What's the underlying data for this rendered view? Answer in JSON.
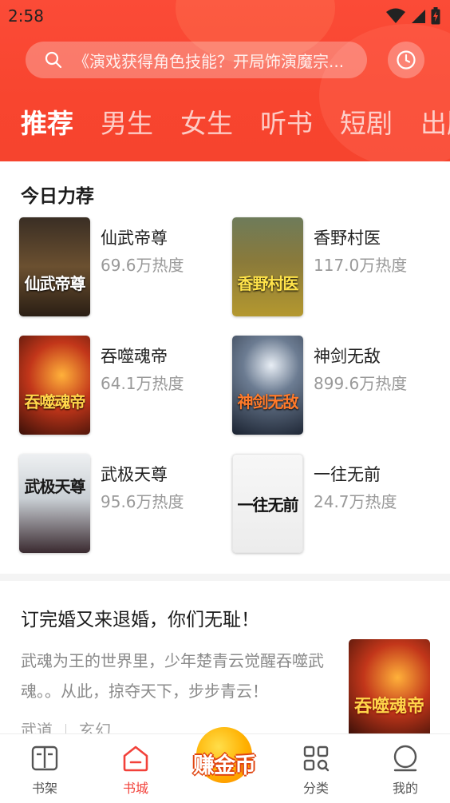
{
  "status_bar": {
    "time": "2:58"
  },
  "search": {
    "placeholder": "《演戏获得角色技能？开局饰演魔宗..."
  },
  "tabs": [
    {
      "label": "推荐",
      "active": true
    },
    {
      "label": "男生"
    },
    {
      "label": "女生"
    },
    {
      "label": "听书"
    },
    {
      "label": "短剧"
    },
    {
      "label": "出版"
    }
  ],
  "recommend": {
    "title": "今日力荐",
    "books": [
      {
        "title": "仙武帝尊",
        "heat": "69.6万热度",
        "cover_text": "仙武帝尊"
      },
      {
        "title": "香野村医",
        "heat": "117.0万热度",
        "cover_text": "香野村医"
      },
      {
        "title": "吞噬魂帝",
        "heat": "64.1万热度",
        "cover_text": "吞噬魂帝"
      },
      {
        "title": "神剑无敌",
        "heat": "899.6万热度",
        "cover_text": "神剑无敌"
      },
      {
        "title": "武极天尊",
        "heat": "95.6万热度",
        "cover_text": "武极天尊"
      },
      {
        "title": "一往无前",
        "heat": "24.7万热度",
        "cover_text": "一往无前"
      }
    ]
  },
  "feature": {
    "title": "订完婚又来退婚，你们无耻！",
    "description": "武魂为王的世界里，少年楚青云觉醒吞噬武魂。。从此，掠夺天下，步步青云！",
    "tags": [
      "武道",
      "玄幻"
    ],
    "cover_text": "吞噬魂帝"
  },
  "bottom_nav": {
    "shelf": "书架",
    "store": "书城",
    "coin": "赚金币",
    "category": "分类",
    "mine": "我的"
  },
  "colors": {
    "accent": "#f8452f",
    "nav_active": "#f2413a"
  }
}
